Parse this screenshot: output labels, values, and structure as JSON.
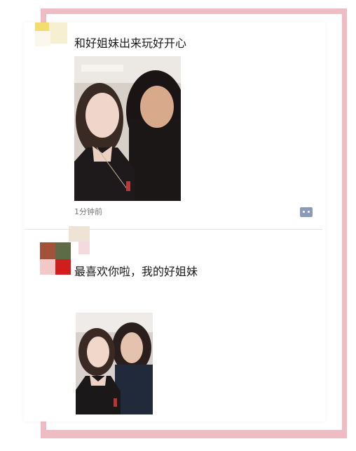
{
  "colors": {
    "frame": "#efbcc3",
    "text": "#1a1a1a",
    "meta": "#777777",
    "comment_icon": "#8a9db8"
  },
  "posts": [
    {
      "text": "和好姐妹出来玩好开心",
      "photo": "selfie-photo",
      "time": "1分钟前",
      "actions": {
        "comment_icon": "comment-icon"
      }
    },
    {
      "text": "最喜欢你啦，我的好姐妹",
      "photo": "selfie-photo"
    }
  ]
}
